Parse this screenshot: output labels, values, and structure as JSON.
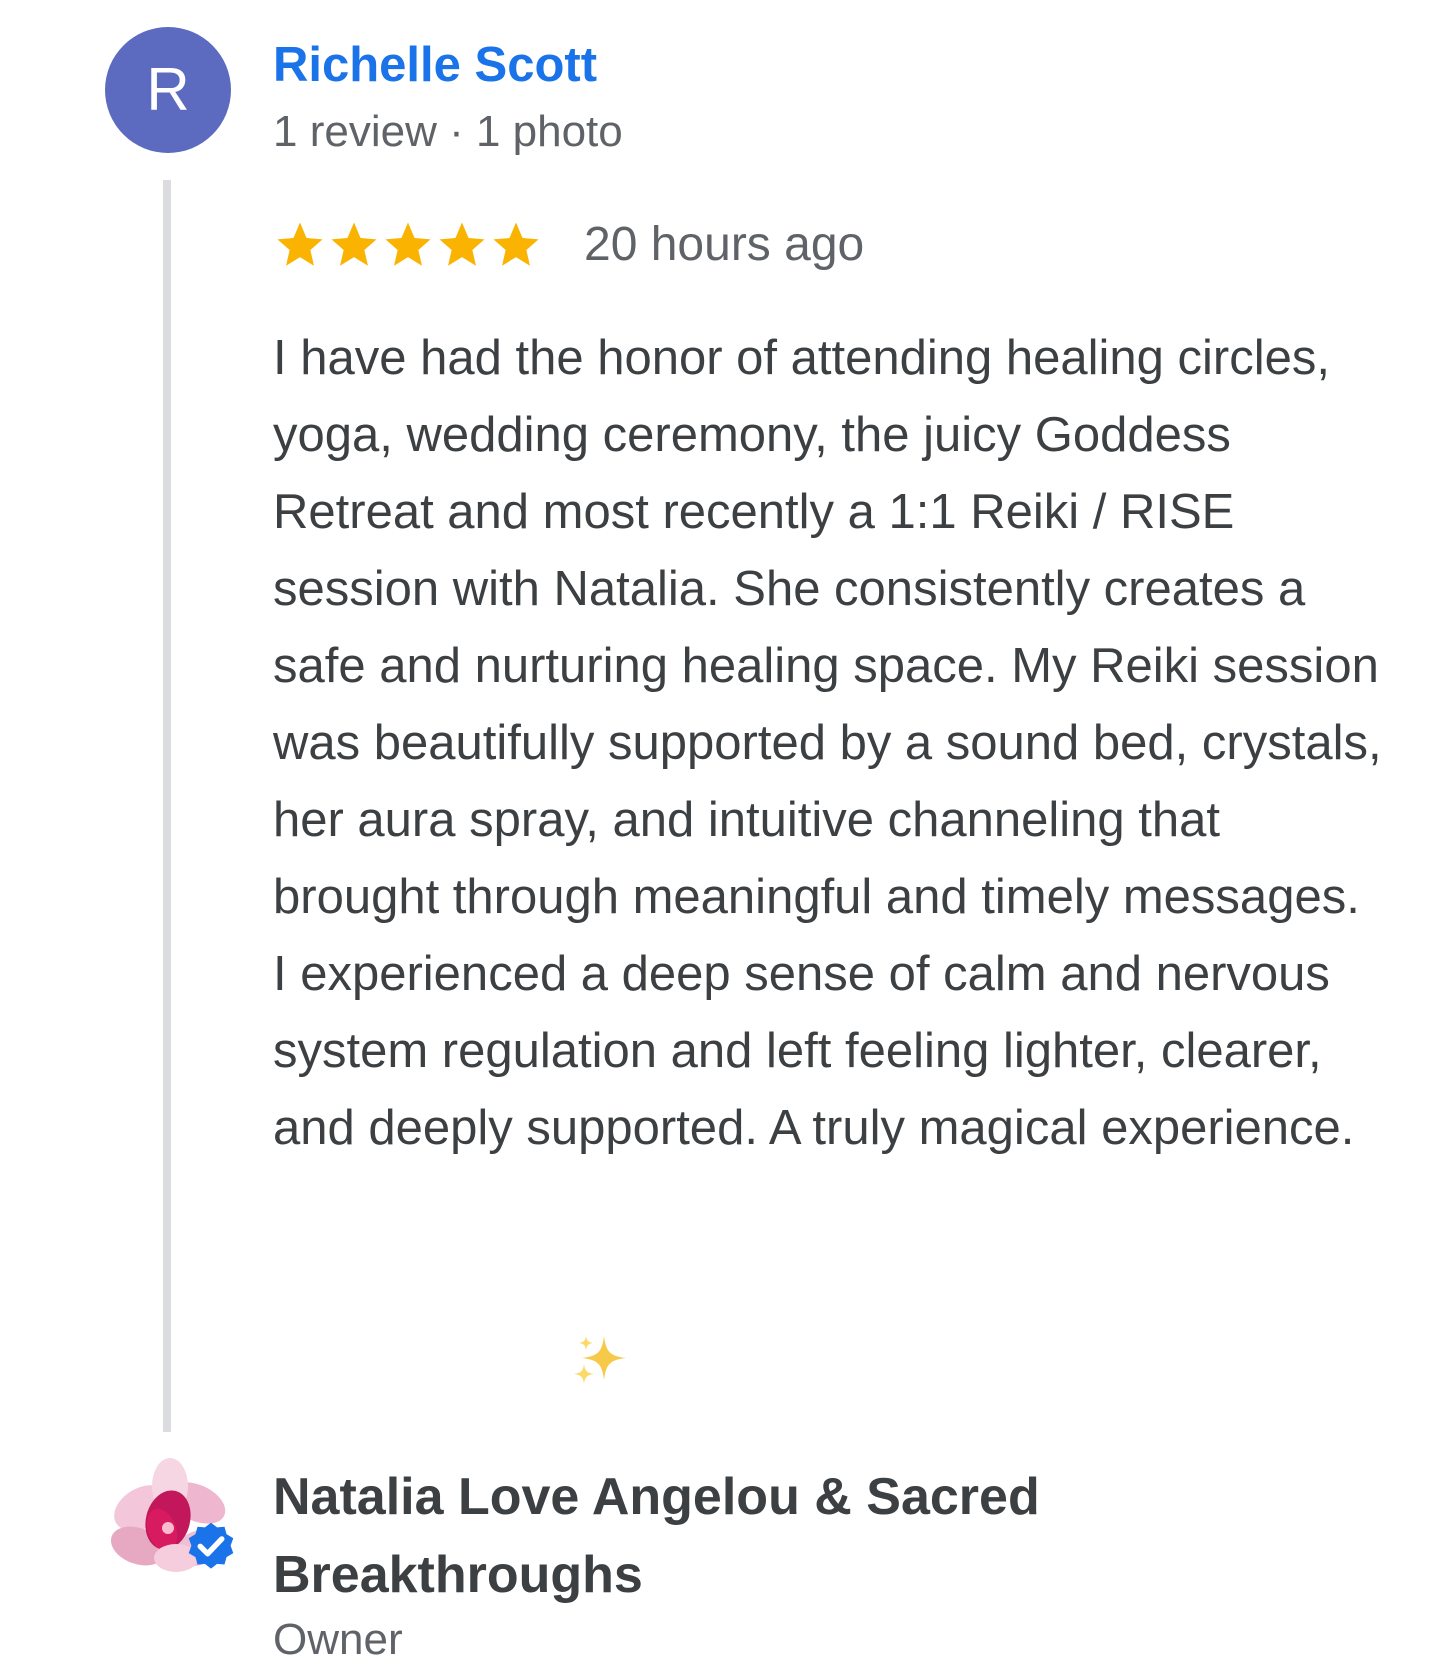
{
  "review": {
    "avatar_letter": "R",
    "avatar_color": "#5c6bc0",
    "reviewer_name": "Richelle Scott",
    "reviewer_meta": "1 review · 1 photo",
    "rating": 5,
    "rating_max": 5,
    "star_color": "#f9b300",
    "time": "20 hours ago",
    "text": "I have had the honor of attending healing circles, yoga, wedding ceremony, the juicy Goddess Retreat and most recently a 1:1 Reiki / RISE session with Natalia. She consistently creates a safe and nurturing healing space. My Reiki session was beautifully supported by a sound bed, crystals, her aura spray, and intuitive channeling that brought through meaningful and timely messages. I experienced a deep sense of calm and nervous system regulation and left feeling lighter, clearer, and deeply supported. A truly magical experience.",
    "sparkle_icon": "sparkles-icon"
  },
  "owner_response": {
    "name": "Natalia Love Angelou & Sacred Breakthroughs",
    "role": "Owner",
    "avatar_icon": "flower-icon",
    "verified_icon": "verified-badge-icon",
    "verified_color": "#1a73e8"
  }
}
